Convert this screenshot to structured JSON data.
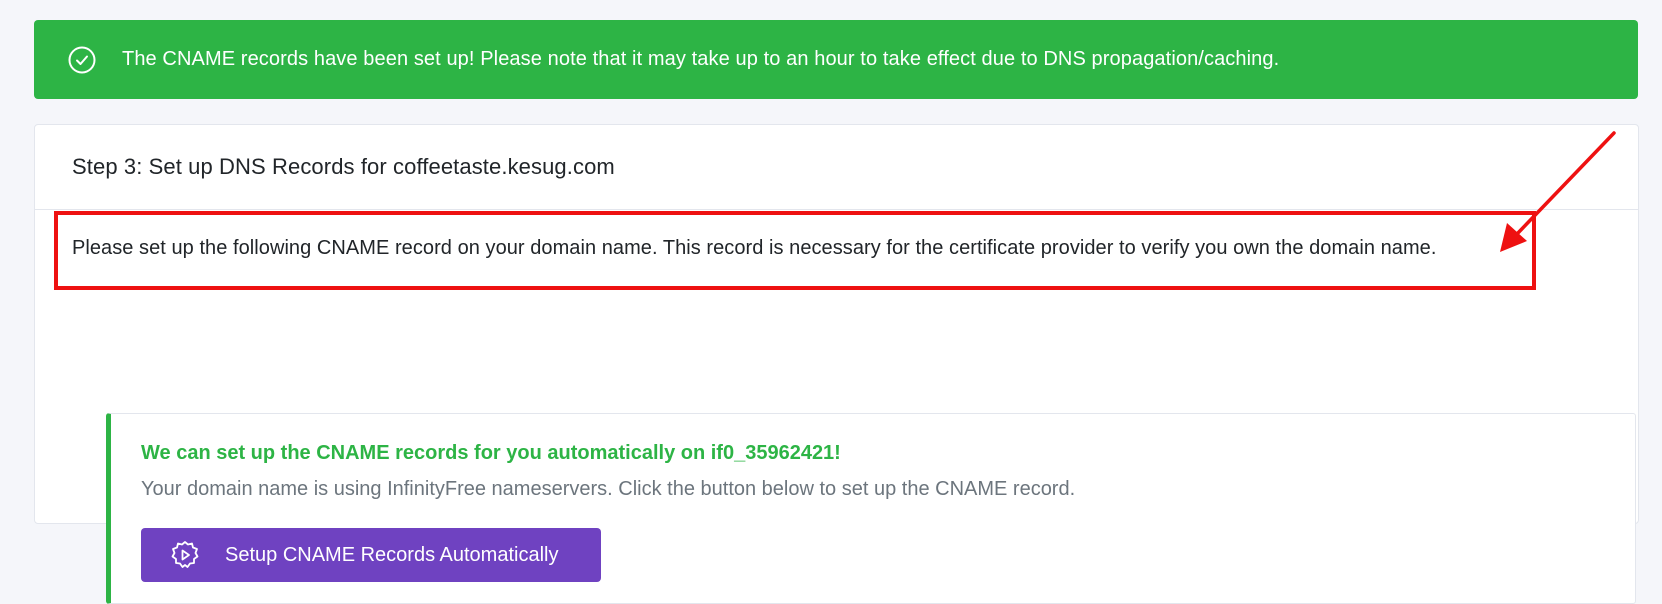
{
  "alert": {
    "message": "The CNAME records have been set up! Please note that it may take up to an hour to take effect due to DNS propagation/caching.",
    "icon": "check-circle-icon"
  },
  "card": {
    "title": "Step 3: Set up DNS Records for coffeetaste.kesug.com",
    "intro": "Please set up the following CNAME record on your domain name. This record is necessary for the certificate provider to verify you own the domain name.",
    "callout": {
      "title": "We can set up the CNAME records for you automatically on if0_35962421!",
      "description": "Your domain name is using InfinityFree nameservers. Click the button below to set up the CNAME record.",
      "button_label": "Setup CNAME Records Automatically",
      "button_icon": "gear-play-icon"
    }
  },
  "colors": {
    "success": "#2db445",
    "primary": "#6f42c1",
    "annotation": "#ee1111",
    "background": "#f5f6fa"
  }
}
